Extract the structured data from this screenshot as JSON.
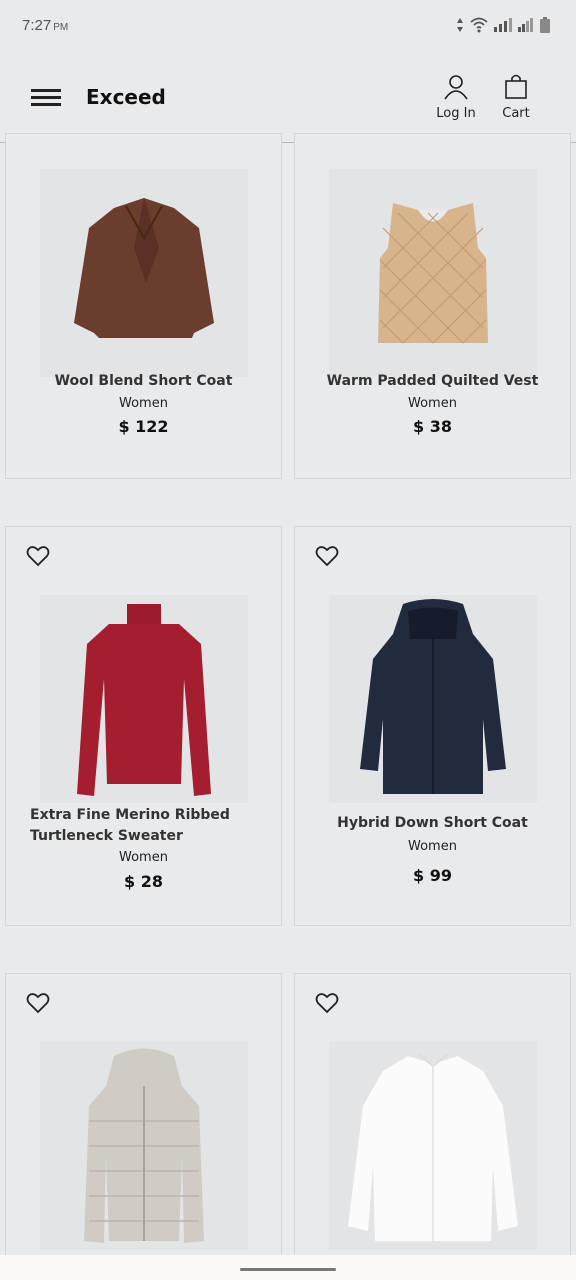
{
  "status": {
    "time": "7:27",
    "ampm": "PM"
  },
  "header": {
    "brand": "Exceed",
    "login_label": "Log In",
    "cart_label": "Cart"
  },
  "products": [
    {
      "name": "Wool Blend Short Coat",
      "category": "Women",
      "price": "$ 122"
    },
    {
      "name": "Warm Padded Quilted Vest",
      "category": "Women",
      "price": "$ 38"
    },
    {
      "name_line1": "Extra Fine Merino Ribbed",
      "name_line2": "Turtleneck Sweater",
      "category": "Women",
      "price": "$ 28"
    },
    {
      "name": "Hybrid Down Short Coat",
      "category": "Women",
      "price": "$ 99"
    },
    {
      "name": "",
      "category": "",
      "price": ""
    },
    {
      "name": "",
      "category": "",
      "price": ""
    }
  ],
  "icons": {
    "menu": "hamburger-icon",
    "login": "user-icon",
    "cart": "shopping-bag-icon",
    "favorite": "heart-icon",
    "status": [
      "signal-sort-icon",
      "wifi-icon",
      "cell-signal-icon",
      "cell-signal-icon",
      "battery-icon"
    ]
  },
  "colors": {
    "background": "#e9eaec",
    "text": "#222222",
    "divider": "#b8b9bb"
  }
}
